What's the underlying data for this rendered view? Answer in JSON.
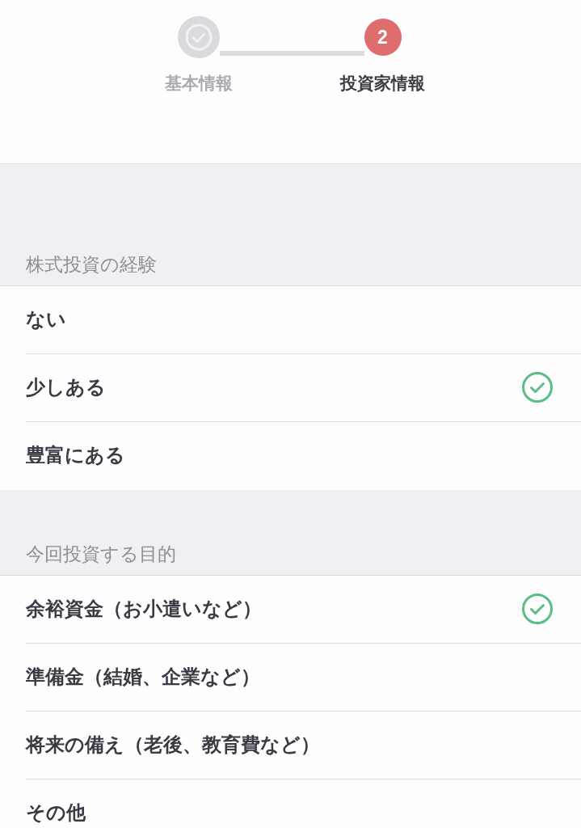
{
  "stepper": {
    "steps": [
      {
        "label": "基本情報",
        "completed": true,
        "current": false
      },
      {
        "label": "投資家情報",
        "number": "2",
        "completed": false,
        "current": true
      }
    ]
  },
  "sections": [
    {
      "title": "株式投資の経験",
      "options": [
        {
          "label": "ない",
          "selected": false
        },
        {
          "label": "少しある",
          "selected": true
        },
        {
          "label": "豊富にある",
          "selected": false
        }
      ]
    },
    {
      "title": "今回投資する目的",
      "options": [
        {
          "label": "余裕資金（お小遣いなど）",
          "selected": true
        },
        {
          "label": "準備金（結婚、企業など）",
          "selected": false
        },
        {
          "label": "将来の備え（老後、教育費など）",
          "selected": false
        },
        {
          "label": "その他",
          "selected": false
        }
      ]
    }
  ]
}
